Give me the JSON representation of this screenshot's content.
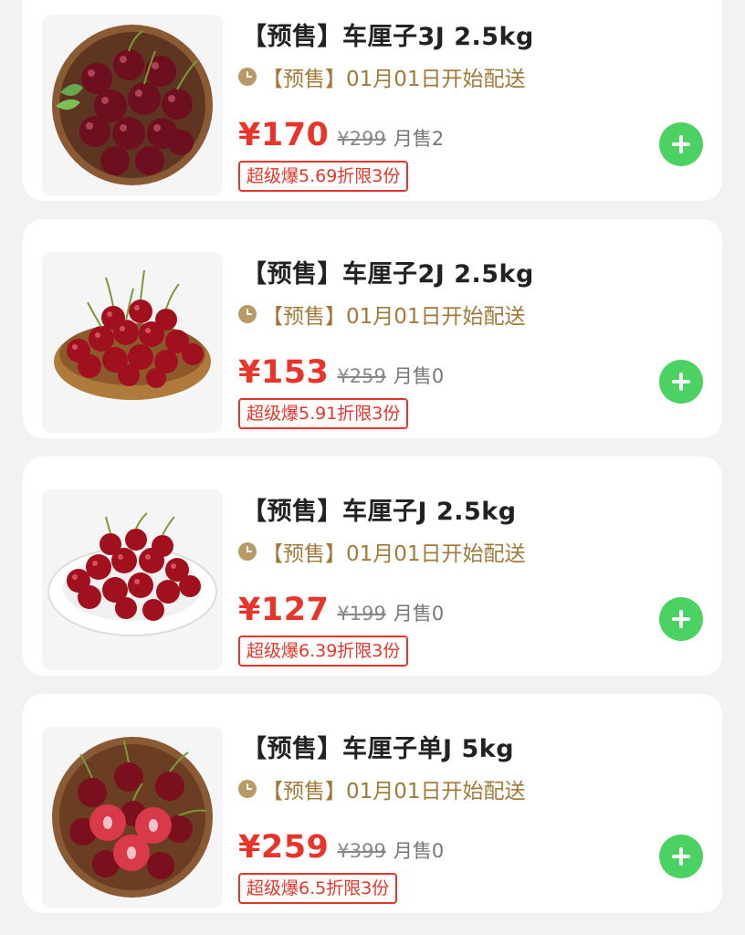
{
  "products": [
    {
      "title": "【预售】车厘子3J 2.5kg",
      "delivery": "【预售】01月01日开始配送",
      "price": "¥170",
      "original_price": "¥299",
      "monthly_sales": "月售2",
      "promo": "超级爆5.69折限3份",
      "image": "cherries-in-wooden-bowl-with-leaves"
    },
    {
      "title": "【预售】车厘子2J 2.5kg",
      "delivery": "【预售】01月01日开始配送",
      "price": "¥153",
      "original_price": "¥259",
      "monthly_sales": "月售0",
      "promo": "超级爆5.91折限3份",
      "image": "cherries-in-wooden-basket"
    },
    {
      "title": "【预售】车厘子J 2.5kg",
      "delivery": "【预售】01月01日开始配送",
      "price": "¥127",
      "original_price": "¥199",
      "monthly_sales": "月售0",
      "promo": "超级爆6.39折限3份",
      "image": "cherries-on-white-plate"
    },
    {
      "title": "【预售】车厘子单J 5kg",
      "delivery": "【预售】01月01日开始配送",
      "price": "¥259",
      "original_price": "¥399",
      "monthly_sales": "月售0",
      "promo": "超级爆6.5折限3份",
      "image": "halved-cherries-in-bowl"
    }
  ],
  "icons": {
    "delivery": "clock-icon",
    "add": "plus-icon"
  },
  "colors": {
    "price": "#e8352b",
    "delivery_text": "#a07a3a",
    "add_button": "#4cd262",
    "background": "#f2f2f2"
  }
}
